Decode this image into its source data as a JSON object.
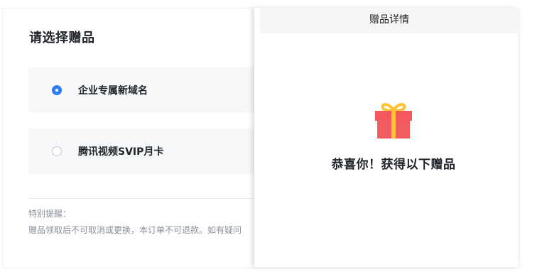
{
  "page": {
    "title": "请选择赠品"
  },
  "options": [
    {
      "label": "企业专属新域名",
      "selected": true
    },
    {
      "label": "腾讯视频SVIP月卡",
      "selected": false
    }
  ],
  "notice": {
    "title": "特别提醒：",
    "text": "赠品领取后不可取消或更换，本订单不可退款。如有疑问"
  },
  "overlay": {
    "header": "赠品详情",
    "message": "恭喜你！获得以下赠品"
  },
  "colors": {
    "accent": "#2b7cf6",
    "gift_red": "#f4585c",
    "gift_ribbon": "#ffc233"
  },
  "icons": {
    "gift": "gift-box-icon"
  }
}
